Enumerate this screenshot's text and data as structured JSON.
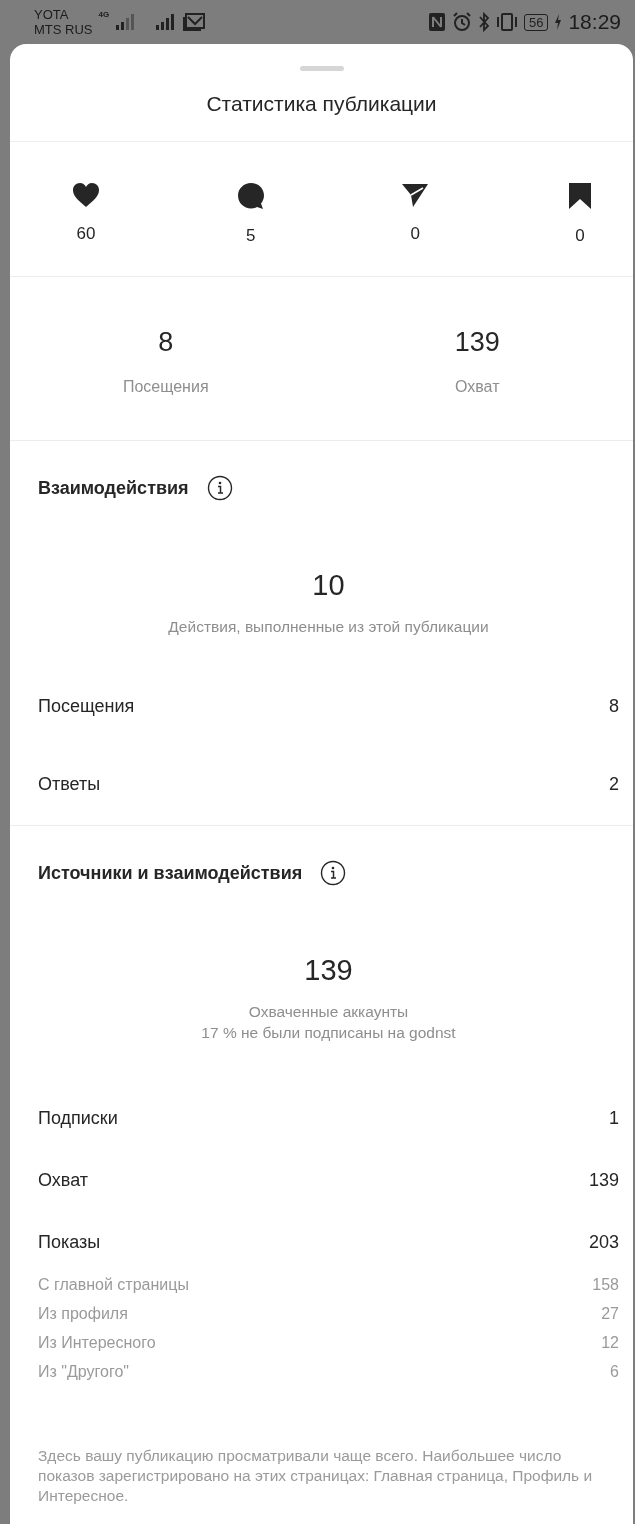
{
  "status_bar": {
    "carriers": [
      "YOTA",
      "MTS RUS"
    ],
    "network": "4G",
    "battery": "56",
    "time": "18:29"
  },
  "sheet": {
    "title": "Статистика публикации"
  },
  "engagement": [
    {
      "kind": "like",
      "count": "60"
    },
    {
      "kind": "comment",
      "count": "5"
    },
    {
      "kind": "share",
      "count": "0"
    },
    {
      "kind": "save",
      "count": "0"
    }
  ],
  "summary": [
    {
      "value": "8",
      "label": "Посещения"
    },
    {
      "value": "139",
      "label": "Охват"
    }
  ],
  "sections": [
    {
      "title": "Взаимодействия",
      "total": "10",
      "captions": [
        "Действия, выполненные из этой публикации"
      ],
      "rows": [
        {
          "label": "Посещения",
          "value": "8"
        },
        {
          "label": "Ответы",
          "value": "2"
        }
      ]
    },
    {
      "title": "Источники и взаимодействия",
      "total": "139",
      "captions": [
        "Охваченные аккаунты",
        "17 % не были подписаны на godnst"
      ],
      "rows": [
        {
          "label": "Подписки",
          "value": "1"
        },
        {
          "label": "Охват",
          "value": "139"
        },
        {
          "label": "Показы",
          "value": "203"
        }
      ],
      "subrows": [
        {
          "label": "С главной страницы",
          "value": "158"
        },
        {
          "label": "Из профиля",
          "value": "27"
        },
        {
          "label": "Из Интересного",
          "value": "12"
        },
        {
          "label": "Из \"Другого\"",
          "value": "6"
        }
      ]
    }
  ],
  "footnote": "Здесь вашу публикацию просматривали чаще всего. Наибольшее число показов зарегистрировано на этих страницах: Главная страница, Профиль и Интересное."
}
